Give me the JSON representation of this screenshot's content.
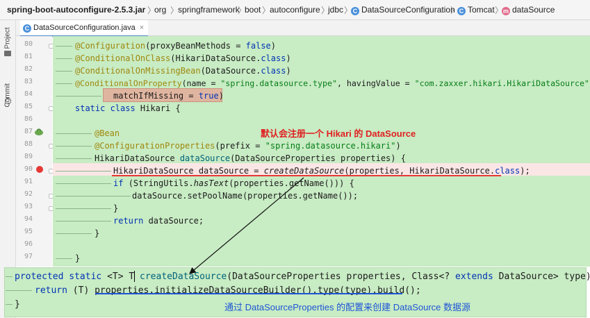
{
  "breadcrumb": {
    "items": [
      "spring-boot-autoconfigure-2.5.3.jar",
      "org",
      "springframework",
      "boot",
      "autoconfigure",
      "jdbc",
      "DataSourceConfiguration",
      "Tomcat",
      "dataSource"
    ],
    "separator": "〉"
  },
  "side_tabs": {
    "project": "Project",
    "commit": "Commit"
  },
  "editor_tab": {
    "label": "DataSourceConfiguration.java",
    "close": "×"
  },
  "line_numbers": [
    "80",
    "81",
    "82",
    "83",
    "84",
    "85",
    "86",
    "87",
    "88",
    "89",
    "90",
    "91",
    "92",
    "93",
    "94",
    "95",
    "96",
    "97"
  ],
  "code": {
    "l80": {
      "ann": "@Configuration",
      "rest1": "(proxyBeanMethods = ",
      "kw": "false",
      "rest2": ")"
    },
    "l81": {
      "ann": "@ConditionalOnClass",
      "rest1": "(HikariDataSource.",
      "kw": "class",
      "rest2": ")"
    },
    "l82": {
      "ann": "@ConditionalOnMissingBean",
      "rest1": "(DataSource.",
      "kw": "class",
      "rest2": ")"
    },
    "l83": {
      "ann": "@ConditionalOnProperty",
      "rest1": "(name = ",
      "str1": "\"spring.datasource.type\"",
      "rest2": ", havingValue = ",
      "str2": "\"com.zaxxer.hikari.HikariDataSource\"",
      "rest3": ","
    },
    "l84": {
      "rest1": "matchIfMissing = ",
      "kw": "true",
      "rest2": ")"
    },
    "l85": {
      "kw": "static class ",
      "rest": "Hikari {"
    },
    "l87": {
      "ann": "@Bean"
    },
    "l88": {
      "ann": "@ConfigurationProperties",
      "rest1": "(prefix = ",
      "str": "\"spring.datasource.hikari\"",
      "rest2": ")"
    },
    "l89": {
      "rest1": "HikariDataSource ",
      "fn": "dataSource",
      "rest2": "(DataSourceProperties properties) {"
    },
    "l90": {
      "rest1": "HikariDataSource dataSource = ",
      "it": "createDataSource",
      "rest2": "(properties, HikariDataSource.",
      "kw": "class",
      "rest3": ");"
    },
    "l91": {
      "kw": "if ",
      "rest1": "(StringUtils.",
      "it": "hasText",
      "rest2": "(properties.getName())) {"
    },
    "l92": {
      "rest": "dataSource.setPoolName(properties.getName());"
    },
    "l93": {
      "rest": "}"
    },
    "l94": {
      "kw": "return ",
      "rest": "dataSource;"
    },
    "l95": {
      "rest": "}"
    },
    "l97": {
      "rest": "}"
    }
  },
  "annotation_top": "默认会注册一个 Hikari 的 DataSource",
  "lower_code": {
    "line1": {
      "kw1": "protected static ",
      "rest1": "<T> T ",
      "fn": "createDataSource",
      "rest2": "(DataSourceProperties properties, Class<? ",
      "kw2": "extends",
      "rest3": " DataSource> type) {"
    },
    "line2": {
      "kw": "return ",
      "rest": "(T) properties.initializeDataSourceBuilder().type(type).build();"
    },
    "line3": {
      "rest": "}"
    }
  },
  "annotation_bottom": "通过 DataSourceProperties 的配置来创建 DataSource 数据源",
  "colors": {
    "editor_bg": "#c8ecc4",
    "note_red": "#e02020",
    "note_blue": "#1e55d6",
    "breakpoint": "#e53935"
  },
  "icons": {
    "class_icon": "C",
    "method_icon": "m"
  }
}
